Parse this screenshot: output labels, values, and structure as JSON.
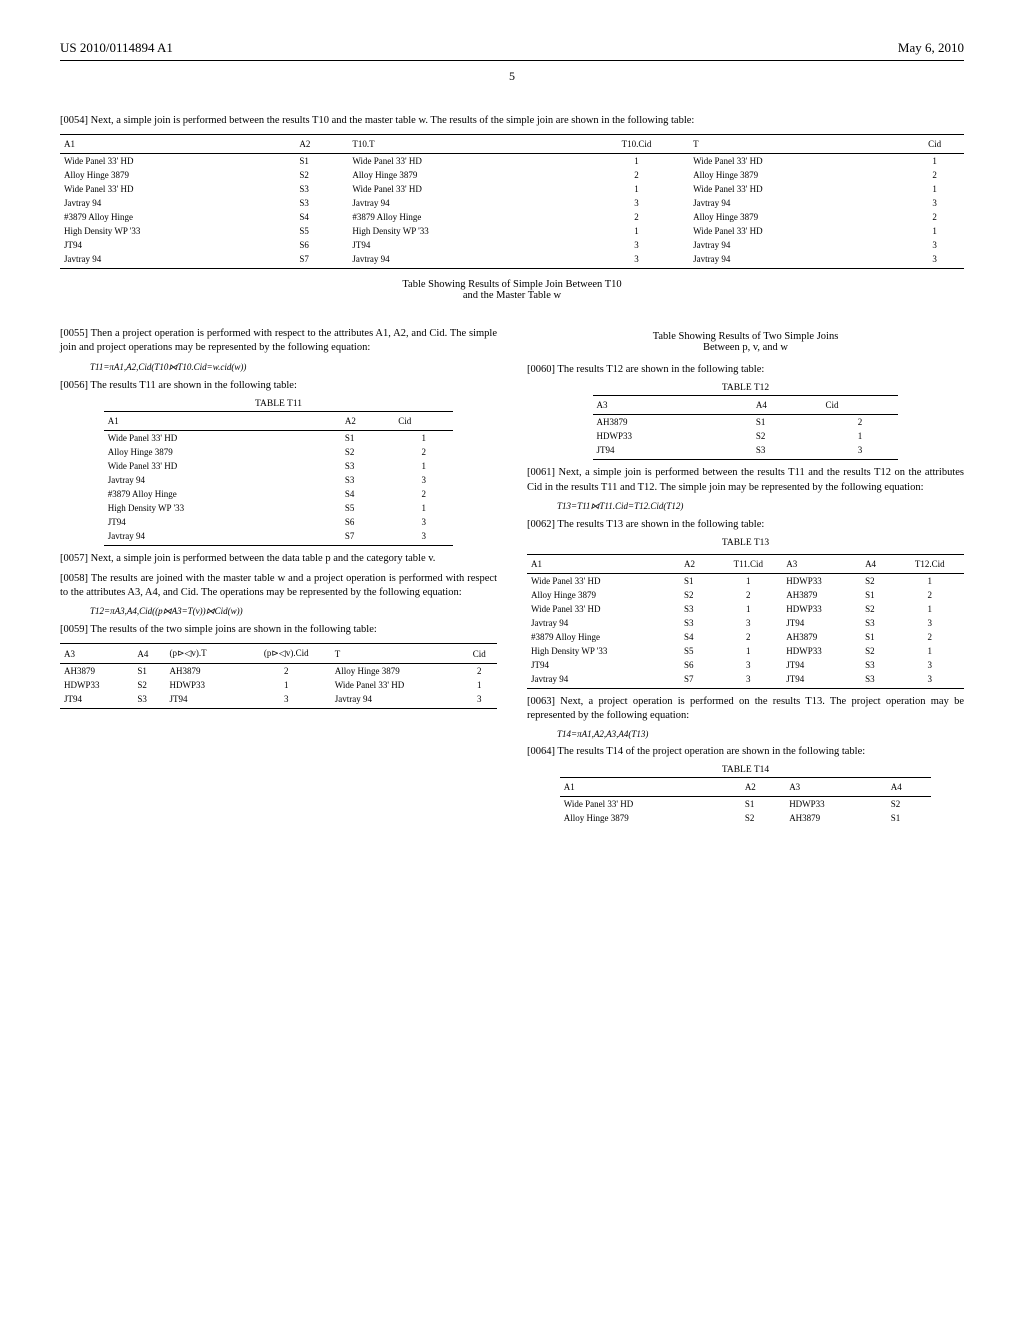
{
  "header": {
    "pub_number": "US 2010/0114894 A1",
    "date": "May 6, 2010"
  },
  "page_number": "5",
  "full": {
    "p0054": "[0054]   Next, a simple join is performed between the results T10 and the master table w. The results of the simple join are shown in the following table:",
    "table1": {
      "headers": [
        "A1",
        "A2",
        "T10.T",
        "T10.Cid",
        "T",
        "Cid"
      ],
      "rows": [
        [
          "Wide Panel 33' HD",
          "S1",
          "Wide Panel 33' HD",
          "1",
          "Wide Panel 33' HD",
          "1"
        ],
        [
          "Alloy Hinge 3879",
          "S2",
          "Alloy Hinge 3879",
          "2",
          "Alloy Hinge 3879",
          "2"
        ],
        [
          "Wide Panel 33' HD",
          "S3",
          "Wide Panel 33' HD",
          "1",
          "Wide Panel 33' HD",
          "1"
        ],
        [
          "Javtray 94",
          "S3",
          "Javtray 94",
          "3",
          "Javtray 94",
          "3"
        ],
        [
          "#3879 Alloy Hinge",
          "S4",
          "#3879 Alloy Hinge",
          "2",
          "Alloy Hinge 3879",
          "2"
        ],
        [
          "High Density WP '33",
          "S5",
          "High Density WP '33",
          "1",
          "Wide Panel 33' HD",
          "1"
        ],
        [
          "JT94",
          "S6",
          "JT94",
          "3",
          "Javtray 94",
          "3"
        ],
        [
          "Javtray 94",
          "S7",
          "Javtray 94",
          "3",
          "Javtray 94",
          "3"
        ]
      ]
    },
    "caption1a": "Table Showing Results of Simple Join Between T10",
    "caption1b": "and the Master Table w"
  },
  "left": {
    "p0055": "[0055]   Then a project operation is performed with respect to the attributes A1, A2, and Cid. The simple join and project operations may be represented by the following equation:",
    "eq1": "T11=πA1,A2,Cid(T10⋈T10.Cid=w.cid(w))",
    "p0056": "[0056]   The results T11 are shown in the following table:",
    "t11_title": "TABLE T11",
    "t11": {
      "headers": [
        "A1",
        "A2",
        "Cid"
      ],
      "rows": [
        [
          "Wide Panel 33' HD",
          "S1",
          "1"
        ],
        [
          "Alloy Hinge 3879",
          "S2",
          "2"
        ],
        [
          "Wide Panel 33' HD",
          "S3",
          "1"
        ],
        [
          "Javtray 94",
          "S3",
          "3"
        ],
        [
          "#3879 Alloy Hinge",
          "S4",
          "2"
        ],
        [
          "High Density WP '33",
          "S5",
          "1"
        ],
        [
          "JT94",
          "S6",
          "3"
        ],
        [
          "Javtray 94",
          "S7",
          "3"
        ]
      ]
    },
    "p0057": "[0057]   Next, a simple join is performed between the data table p and the category table v.",
    "p0058": "[0058]   The results are joined with the master table w and a project operation is performed with respect to the attributes A3, A4, and Cid. The operations may be represented by the following equation:",
    "eq2": "T12=πA3,A4,Cid((p⋈A3=T(v))⋈Cid(w))",
    "p0059": "[0059]   The results of the two simple joins are shown in the following table:",
    "tablejoin": {
      "headers": [
        "A3",
        "A4",
        "(p⊳◁v).T",
        "(p⊳◁v).Cid",
        "T",
        "Cid"
      ],
      "rows": [
        [
          "AH3879",
          "S1",
          "AH3879",
          "2",
          "Alloy Hinge 3879",
          "2"
        ],
        [
          "HDWP33",
          "S2",
          "HDWP33",
          "1",
          "Wide Panel 33' HD",
          "1"
        ],
        [
          "JT94",
          "S3",
          "JT94",
          "3",
          "Javtray 94",
          "3"
        ]
      ]
    }
  },
  "right": {
    "caption2a": "Table Showing Results of Two Simple Joins",
    "caption2b": "Between p, v, and w",
    "p0060": "[0060]   The results T12 are shown in the following table:",
    "t12_title": "TABLE T12",
    "t12": {
      "headers": [
        "A3",
        "A4",
        "Cid"
      ],
      "rows": [
        [
          "AH3879",
          "S1",
          "2"
        ],
        [
          "HDWP33",
          "S2",
          "1"
        ],
        [
          "JT94",
          "S3",
          "3"
        ]
      ]
    },
    "p0061": "[0061]   Next, a simple join is performed between the results T11 and the results T12 on the attributes Cid in the results T11 and T12. The simple join may be represented by the following equation:",
    "eq3": "T13=T11⋈T11.Cid=T12.Cid(T12)",
    "p0062": "[0062]   The results T13 are shown in the following table:",
    "t13_title": "TABLE T13",
    "t13": {
      "headers": [
        "A1",
        "A2",
        "T11.Cid",
        "A3",
        "A4",
        "T12.Cid"
      ],
      "rows": [
        [
          "Wide Panel 33' HD",
          "S1",
          "1",
          "HDWP33",
          "S2",
          "1"
        ],
        [
          "Alloy Hinge 3879",
          "S2",
          "2",
          "AH3879",
          "S1",
          "2"
        ],
        [
          "Wide Panel 33' HD",
          "S3",
          "1",
          "HDWP33",
          "S2",
          "1"
        ],
        [
          "Javtray 94",
          "S3",
          "3",
          "JT94",
          "S3",
          "3"
        ],
        [
          "#3879 Alloy Hinge",
          "S4",
          "2",
          "AH3879",
          "S1",
          "2"
        ],
        [
          "High Density WP '33",
          "S5",
          "1",
          "HDWP33",
          "S2",
          "1"
        ],
        [
          "JT94",
          "S6",
          "3",
          "JT94",
          "S3",
          "3"
        ],
        [
          "Javtray 94",
          "S7",
          "3",
          "JT94",
          "S3",
          "3"
        ]
      ]
    },
    "p0063": "[0063]   Next, a project operation is performed on the results T13. The project operation may be represented by the following equation:",
    "eq4": "T14=πA1,A2,A3,A4(T13)",
    "p0064": "[0064]   The results T14 of the project operation are shown in the following table:",
    "t14_title": "TABLE T14",
    "t14": {
      "headers": [
        "A1",
        "A2",
        "A3",
        "A4"
      ],
      "rows": [
        [
          "Wide Panel 33' HD",
          "S1",
          "HDWP33",
          "S2"
        ],
        [
          "Alloy Hinge 3879",
          "S2",
          "AH3879",
          "S1"
        ]
      ]
    }
  }
}
